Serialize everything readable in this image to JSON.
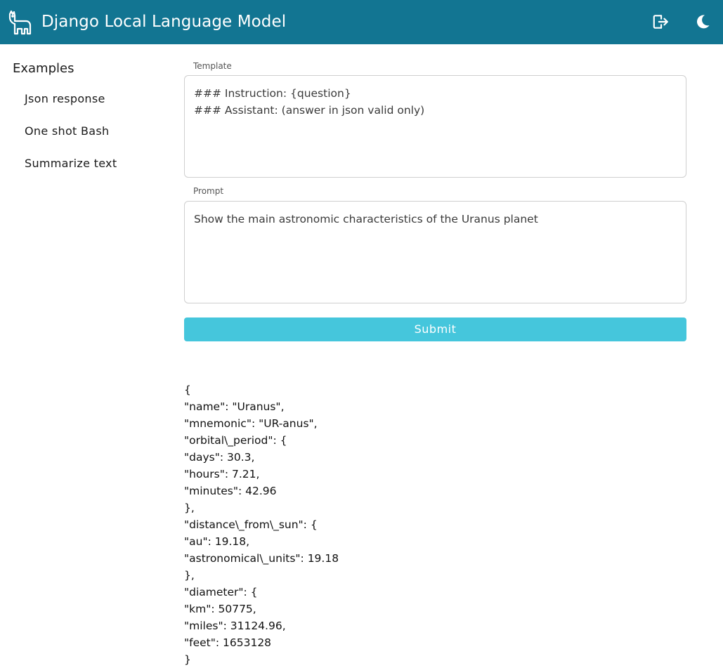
{
  "header": {
    "title": "Django Local Language Model",
    "logo_icon": "llama-icon",
    "logout_icon": "logout-icon",
    "theme_icon": "moon-icon",
    "background_color": "#127592"
  },
  "sidebar": {
    "heading": "Examples",
    "items": [
      {
        "label": "Json response"
      },
      {
        "label": "One shot Bash"
      },
      {
        "label": "Summarize text"
      }
    ]
  },
  "form": {
    "template_label": "Template",
    "template_value": "### Instruction: {question}\n### Assistant: (answer in json valid only)",
    "prompt_label": "Prompt",
    "prompt_value": "Show the main astronomic characteristics of the Uranus planet",
    "submit_label": "Submit",
    "submit_color": "#45c6dc"
  },
  "response": {
    "lines": [
      "{",
      "\"name\": \"Uranus\",",
      "\"mnemonic\": \"UR-anus\",",
      "\"orbital\\_period\": {",
      "\"days\": 30.3,",
      "\"hours\": 7.21,",
      "\"minutes\": 42.96",
      "},",
      "\"distance\\_from\\_sun\": {",
      "\"au\": 19.18,",
      "\"astronomical\\_units\": 19.18",
      "},",
      "\"diameter\": {",
      "\"km\": 50775,",
      "\"miles\": 31124.96,",
      "\"feet\": 1653128",
      "}"
    ]
  }
}
